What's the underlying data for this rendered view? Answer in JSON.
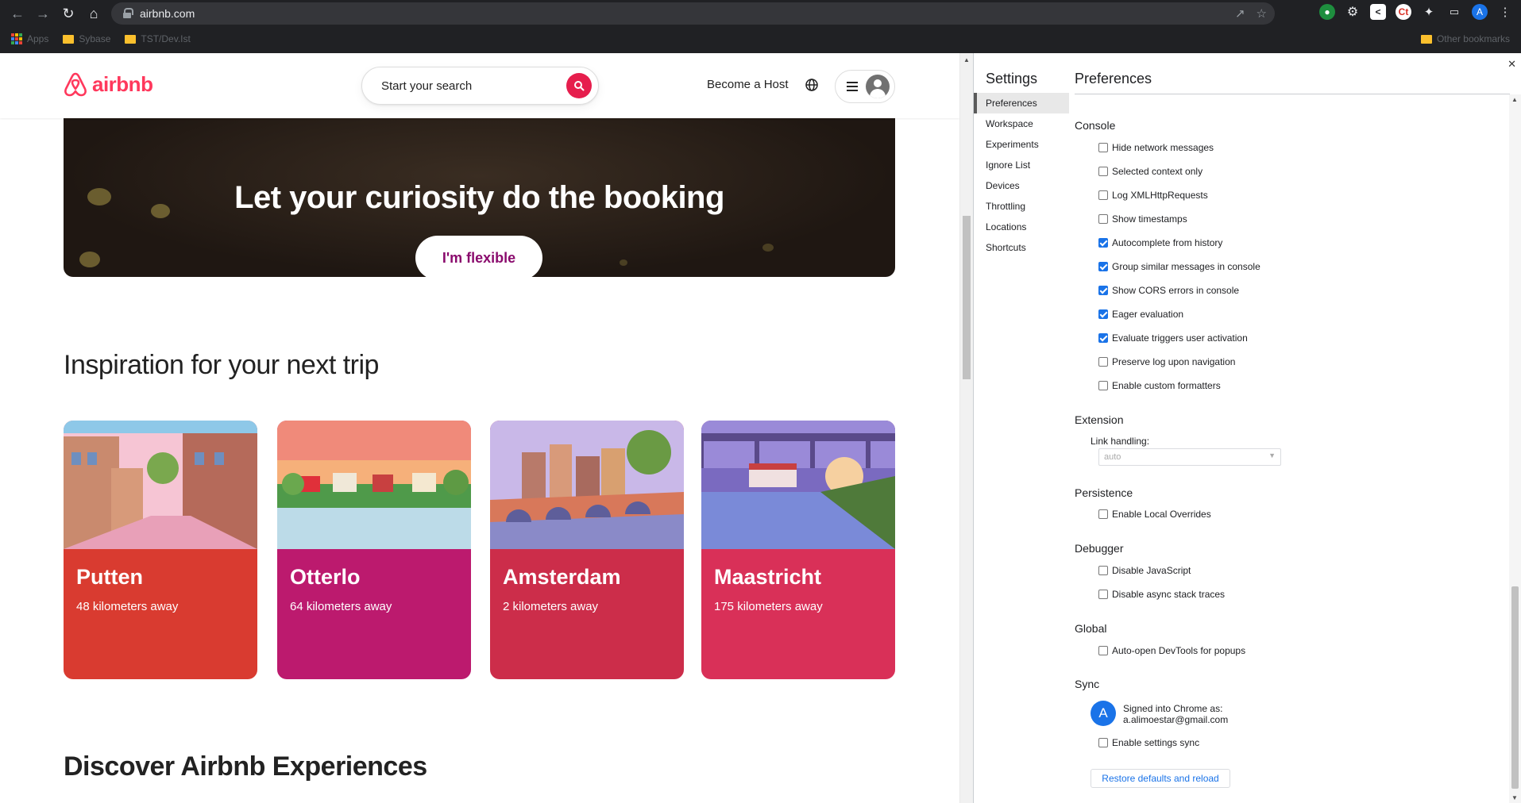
{
  "browser": {
    "url": "airbnb.com",
    "bookmarks": [
      "Apps",
      "Sybase",
      "TST/Dev.Ist"
    ],
    "other_bookmarks": "Other bookmarks",
    "profile_initial": "A",
    "ext_initial": "Ct"
  },
  "airbnb": {
    "logo_text": "airbnb",
    "search_placeholder": "Start your search",
    "become_host": "Become a Host",
    "hero_title": "Let your curiosity do the booking",
    "flexible_button": "I'm flexible",
    "inspiration_title": "Inspiration for your next trip",
    "cards": [
      {
        "city": "Putten",
        "distance": "48 kilometers away",
        "color": "#d93b30"
      },
      {
        "city": "Otterlo",
        "distance": "64 kilometers away",
        "color": "#bc1a6e"
      },
      {
        "city": "Amsterdam",
        "distance": "2 kilometers away",
        "color": "#cc2d4a"
      },
      {
        "city": "Maastricht",
        "distance": "175 kilometers away",
        "color": "#d93058"
      }
    ],
    "discover_title": "Discover Airbnb Experiences"
  },
  "devtools": {
    "settings_title": "Settings",
    "nav": [
      "Preferences",
      "Workspace",
      "Experiments",
      "Ignore List",
      "Devices",
      "Throttling",
      "Locations",
      "Shortcuts"
    ],
    "preferences_title": "Preferences",
    "console": {
      "title": "Console",
      "items": [
        {
          "label": "Hide network messages",
          "checked": false
        },
        {
          "label": "Selected context only",
          "checked": false
        },
        {
          "label": "Log XMLHttpRequests",
          "checked": false
        },
        {
          "label": "Show timestamps",
          "checked": false
        },
        {
          "label": "Autocomplete from history",
          "checked": true
        },
        {
          "label": "Group similar messages in console",
          "checked": true
        },
        {
          "label": "Show CORS errors in console",
          "checked": true
        },
        {
          "label": "Eager evaluation",
          "checked": true
        },
        {
          "label": "Evaluate triggers user activation",
          "checked": true
        },
        {
          "label": "Preserve log upon navigation",
          "checked": false
        },
        {
          "label": "Enable custom formatters",
          "checked": false
        }
      ]
    },
    "extension": {
      "title": "Extension",
      "link_label": "Link handling:",
      "link_value": "auto"
    },
    "persistence": {
      "title": "Persistence",
      "items": [
        {
          "label": "Enable Local Overrides",
          "checked": false
        }
      ]
    },
    "debugger": {
      "title": "Debugger",
      "items": [
        {
          "label": "Disable JavaScript",
          "checked": false
        },
        {
          "label": "Disable async stack traces",
          "checked": false
        }
      ]
    },
    "global": {
      "title": "Global",
      "items": [
        {
          "label": "Auto-open DevTools for popups",
          "checked": false
        }
      ]
    },
    "sync": {
      "title": "Sync",
      "avatar_initial": "A",
      "signed_in_line1": "Signed into Chrome as:",
      "signed_in_line2": "a.alimoestar@gmail.com",
      "items": [
        {
          "label": "Enable settings sync",
          "checked": false
        }
      ]
    },
    "restore_button": "Restore defaults and reload"
  }
}
